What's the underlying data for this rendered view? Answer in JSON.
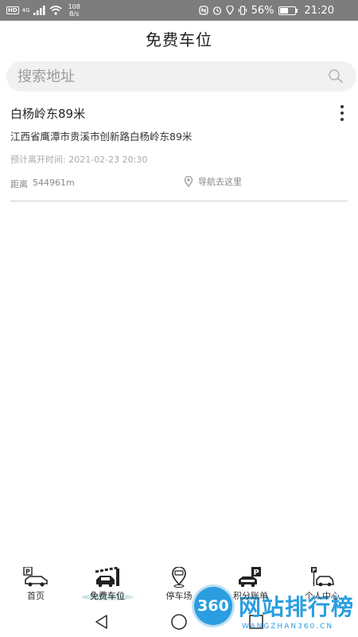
{
  "status_bar": {
    "hd": "HD",
    "network": "4G",
    "speed_value": "108",
    "speed_unit": "B/s",
    "battery_percent": "56%",
    "battery_level": 0.56,
    "time": "21:20"
  },
  "header": {
    "title": "免费车位"
  },
  "search": {
    "placeholder": "搜索地址",
    "value": ""
  },
  "items": [
    {
      "name": "白杨岭东89米",
      "address": "江西省鹰潭市贵溪市创新路白杨岭东89米",
      "eta": "预计离开时间: 2021-02-23 20:30",
      "distance_label": "距离",
      "distance_value": "544961m",
      "navigate_label": "导航去这里"
    }
  ],
  "tabs": [
    {
      "label": "首页",
      "icon": "car-parking-icon"
    },
    {
      "label": "免费车位",
      "icon": "car-barrier-icon",
      "active": true
    },
    {
      "label": "停车场",
      "icon": "parking-pin-icon"
    },
    {
      "label": "积分账单",
      "icon": "car-points-icon"
    },
    {
      "label": "个人中心",
      "icon": "garage-icon"
    }
  ],
  "watermark": {
    "logo": "360",
    "text": "网站排行榜",
    "sub": "WANGZHAN360.CN"
  }
}
